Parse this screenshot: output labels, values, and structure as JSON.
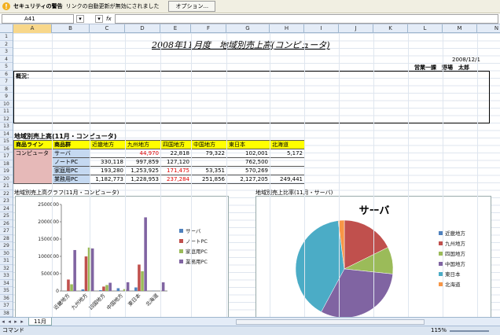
{
  "security_bar": {
    "title": "セキュリティの警告",
    "message": "リンクの自動更新が無効にされました",
    "options_button": "オプション..."
  },
  "formula_bar": {
    "name_box": "A41",
    "fx": "fx",
    "value": ""
  },
  "columns": [
    "A",
    "B",
    "C",
    "D",
    "E",
    "F",
    "G",
    "H",
    "I",
    "J",
    "K",
    "L",
    "M",
    "N"
  ],
  "rows": [
    "1",
    "2",
    "3",
    "4",
    "5",
    "6",
    "7",
    "8",
    "9",
    "10",
    "11",
    "12",
    "13",
    "14",
    "15",
    "16",
    "17",
    "18",
    "19",
    "20",
    "21",
    "22",
    "23",
    "24",
    "25",
    "26",
    "27",
    "28",
    "29",
    "30",
    "31",
    "32",
    "33",
    "34",
    "35",
    "36",
    "37",
    "38"
  ],
  "sheet": {
    "title": "2008年11月度　地域別売上高(コンピュータ)",
    "date": "2008/12/1",
    "author": "営業一課　野場　太郎",
    "overview_label": "概況：",
    "table_title": "地域別売上高(11月・コンピュータ)"
  },
  "table": {
    "headers": [
      "商品ライン",
      "商品群",
      "近畿地方",
      "九州地方",
      "四国地方",
      "中国地方",
      "東日本",
      "北海道"
    ],
    "line": "コンピュータ",
    "rows": [
      {
        "group": "サーバ",
        "values": [
          "",
          "44,970",
          "22,818",
          "79,322",
          "102,001",
          "5,172"
        ]
      },
      {
        "group": "ノートPC",
        "values": [
          "330,118",
          "997,859",
          "127,120",
          "",
          "762,500",
          ""
        ]
      },
      {
        "group": "家庭用PC",
        "values": [
          "193,280",
          "1,253,925",
          "171,475",
          "53,351",
          "570,269",
          ""
        ]
      },
      {
        "group": "業務用PC",
        "values": [
          "1,182,773",
          "1,228,953",
          "237,284",
          "251,856",
          "2,127,205",
          "249,441"
        ]
      }
    ]
  },
  "bar_chart_title": "地域別売上高グラフ(11月・コンピュータ)",
  "pie_chart_title": "地域別売上比率(11月・サーバ)",
  "chart_data": [
    {
      "type": "bar",
      "title": "",
      "categories": [
        "近畿地方",
        "九州地方",
        "四国地方",
        "中国地方",
        "東日本",
        "北海道"
      ],
      "series": [
        {
          "name": "サーバ",
          "color": "#4f81bd",
          "values": [
            0,
            44970,
            22818,
            79322,
            102001,
            5172
          ]
        },
        {
          "name": "ノートPC",
          "color": "#c0504d",
          "values": [
            330118,
            997859,
            127120,
            0,
            762500,
            0
          ]
        },
        {
          "name": "家庭用PC",
          "color": "#9bbb59",
          "values": [
            193280,
            1253925,
            171475,
            53351,
            570269,
            0
          ]
        },
        {
          "name": "業務用PC",
          "color": "#8064a2",
          "values": [
            1182773,
            1228953,
            237284,
            251856,
            2127205,
            249441
          ]
        }
      ],
      "yticks": [
        "0",
        "500000",
        "1000000",
        "1500000",
        "2000000",
        "2500000"
      ],
      "ylim": [
        0,
        2500000
      ],
      "grid": false,
      "legend": "right"
    },
    {
      "type": "pie",
      "title": "サーバ",
      "labels": [
        "近畿地方",
        "九州地方",
        "四国地方",
        "中国地方",
        "東日本",
        "北海道"
      ],
      "values": [
        0,
        44970,
        22818,
        79322,
        102001,
        5172
      ],
      "colors": [
        "#4f81bd",
        "#c0504d",
        "#9bbb59",
        "#8064a2",
        "#4bacc6",
        "#f79646"
      ],
      "legend": "right"
    }
  ],
  "sheet_tab": "11月",
  "status": {
    "mode": "コマンド",
    "zoom": "115%"
  }
}
